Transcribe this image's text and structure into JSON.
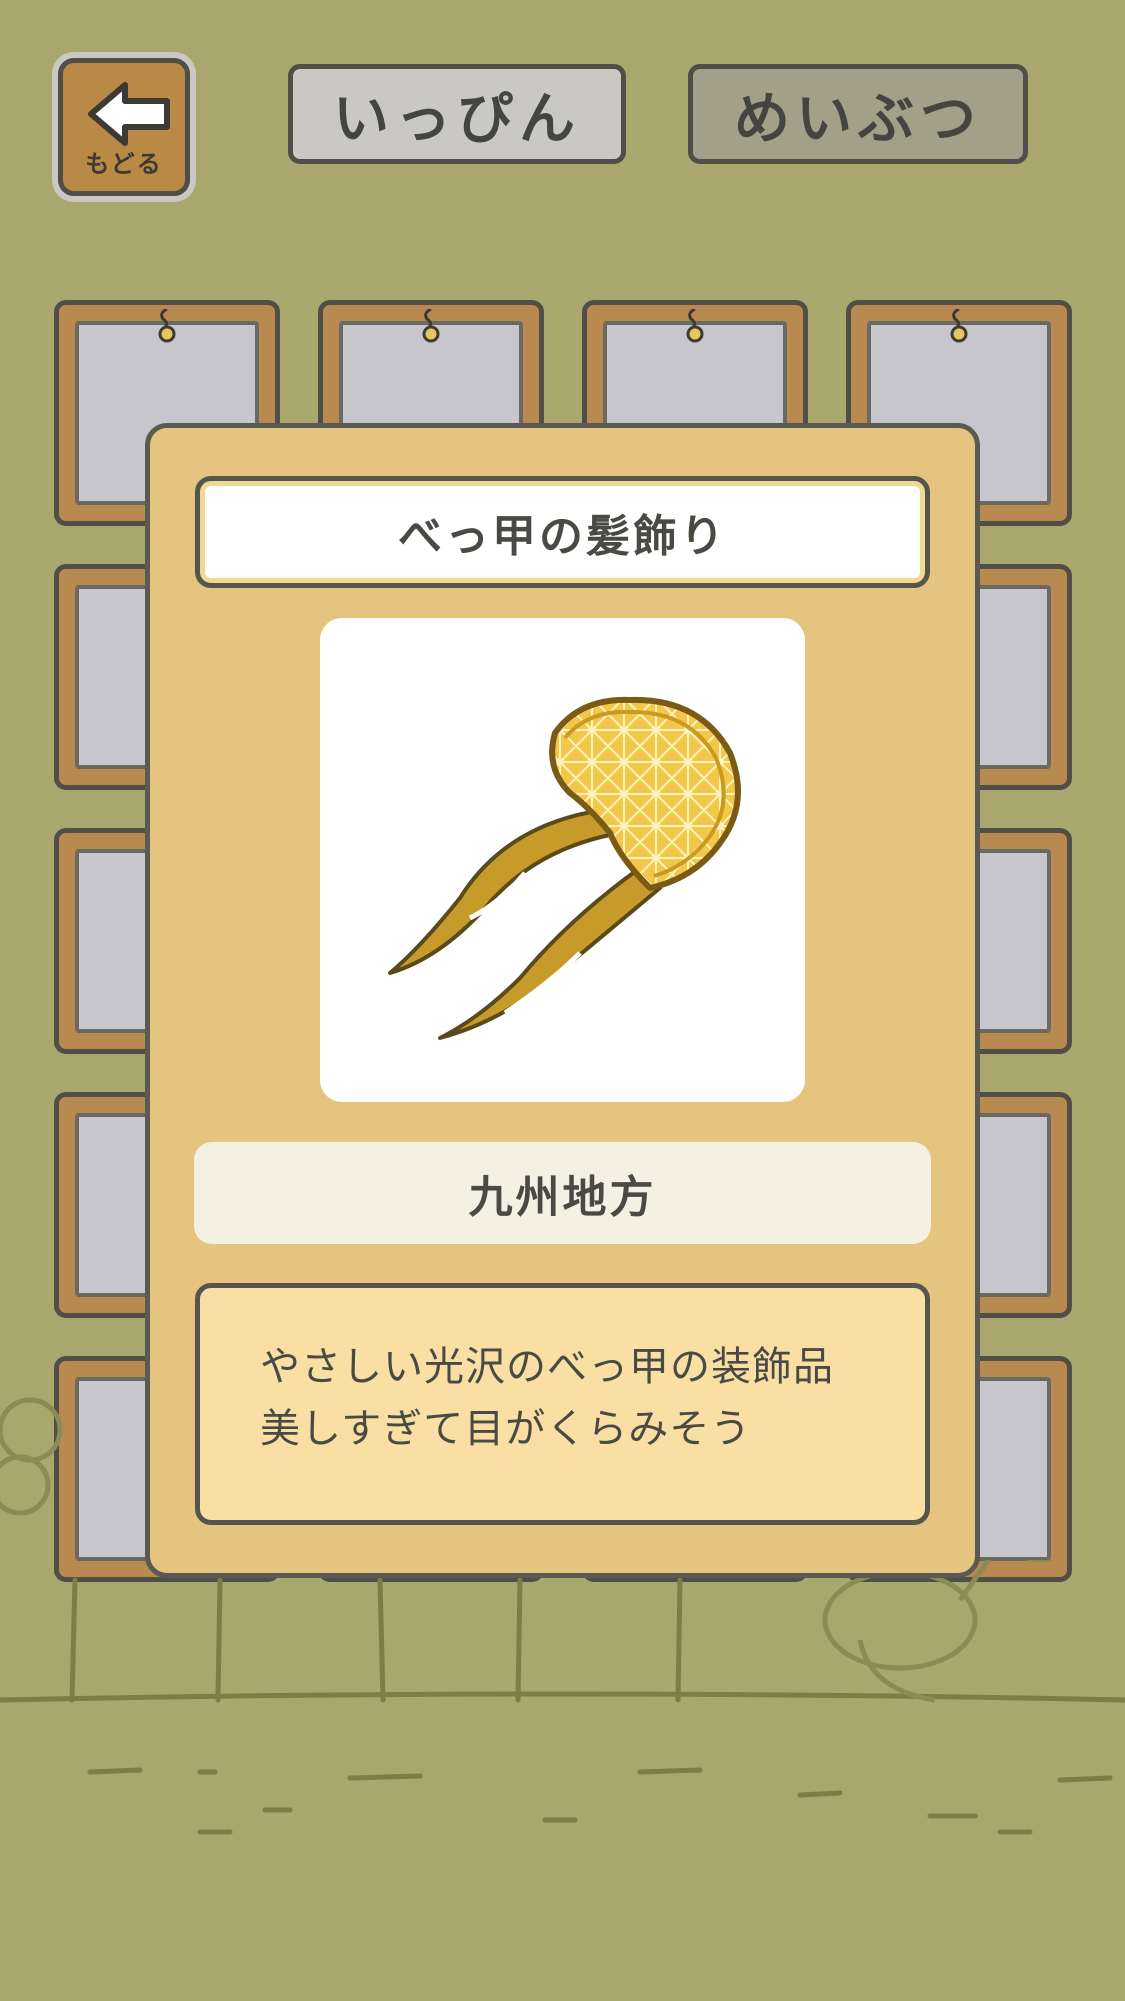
{
  "header": {
    "back_label": "もどる",
    "tabs": [
      {
        "label": "いっぴん",
        "selected": false
      },
      {
        "label": "めいぶつ",
        "selected": true
      }
    ]
  },
  "grid": {
    "visible_items": [
      "bird-figurine",
      "sandals",
      "kokeshi-doll",
      "red-fish-figure",
      "daruma",
      "",
      "",
      "feather",
      "maneki-neko",
      "",
      "",
      "mask",
      "lacquer-box",
      "",
      "",
      "paper-crane",
      "hairpin",
      "",
      "",
      ""
    ]
  },
  "modal": {
    "title": "べっ甲の髪飾り",
    "item_icon": "tortoiseshell-hairpin-icon",
    "region": "九州地方",
    "description_lines": [
      "やさしい光沢のべっ甲の装飾品",
      "美しすぎて目がくらみそう"
    ]
  },
  "colors": {
    "background": "#a9a66e",
    "modal": "#e5c47f",
    "description_panel": "#f9dfa3",
    "frame_wood": "#b88a4f"
  }
}
